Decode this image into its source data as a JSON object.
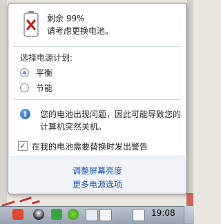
{
  "battery": {
    "percent_label": "剩余 99%",
    "message": "请考虑更换电池。",
    "level": 0.99
  },
  "power_plan": {
    "title": "选择电源计划:",
    "options": [
      {
        "label": "平衡",
        "selected": true
      },
      {
        "label": "节能",
        "selected": false
      }
    ]
  },
  "warning": {
    "line1": "您的电池出现问题，因此可能导致您的",
    "line2": "计算机突然关机。"
  },
  "checkbox": {
    "label": "在我的电池需要替换时发出警告",
    "checked": true,
    "mark": "✓"
  },
  "links": {
    "brightness": "调整屏幕亮度",
    "more_power_options": "更多电源选项"
  },
  "taskbar": {
    "time": "19:08",
    "tray_icons": [
      "sogou-ime-icon",
      "qq-icon",
      "security-icon",
      "settings-icon",
      "battery-icon",
      "volume-icon",
      "network-icon"
    ]
  },
  "colors": {
    "link": "#1c56b0",
    "error_red": "#d0171e",
    "selected_radio": "#1b5fae"
  }
}
